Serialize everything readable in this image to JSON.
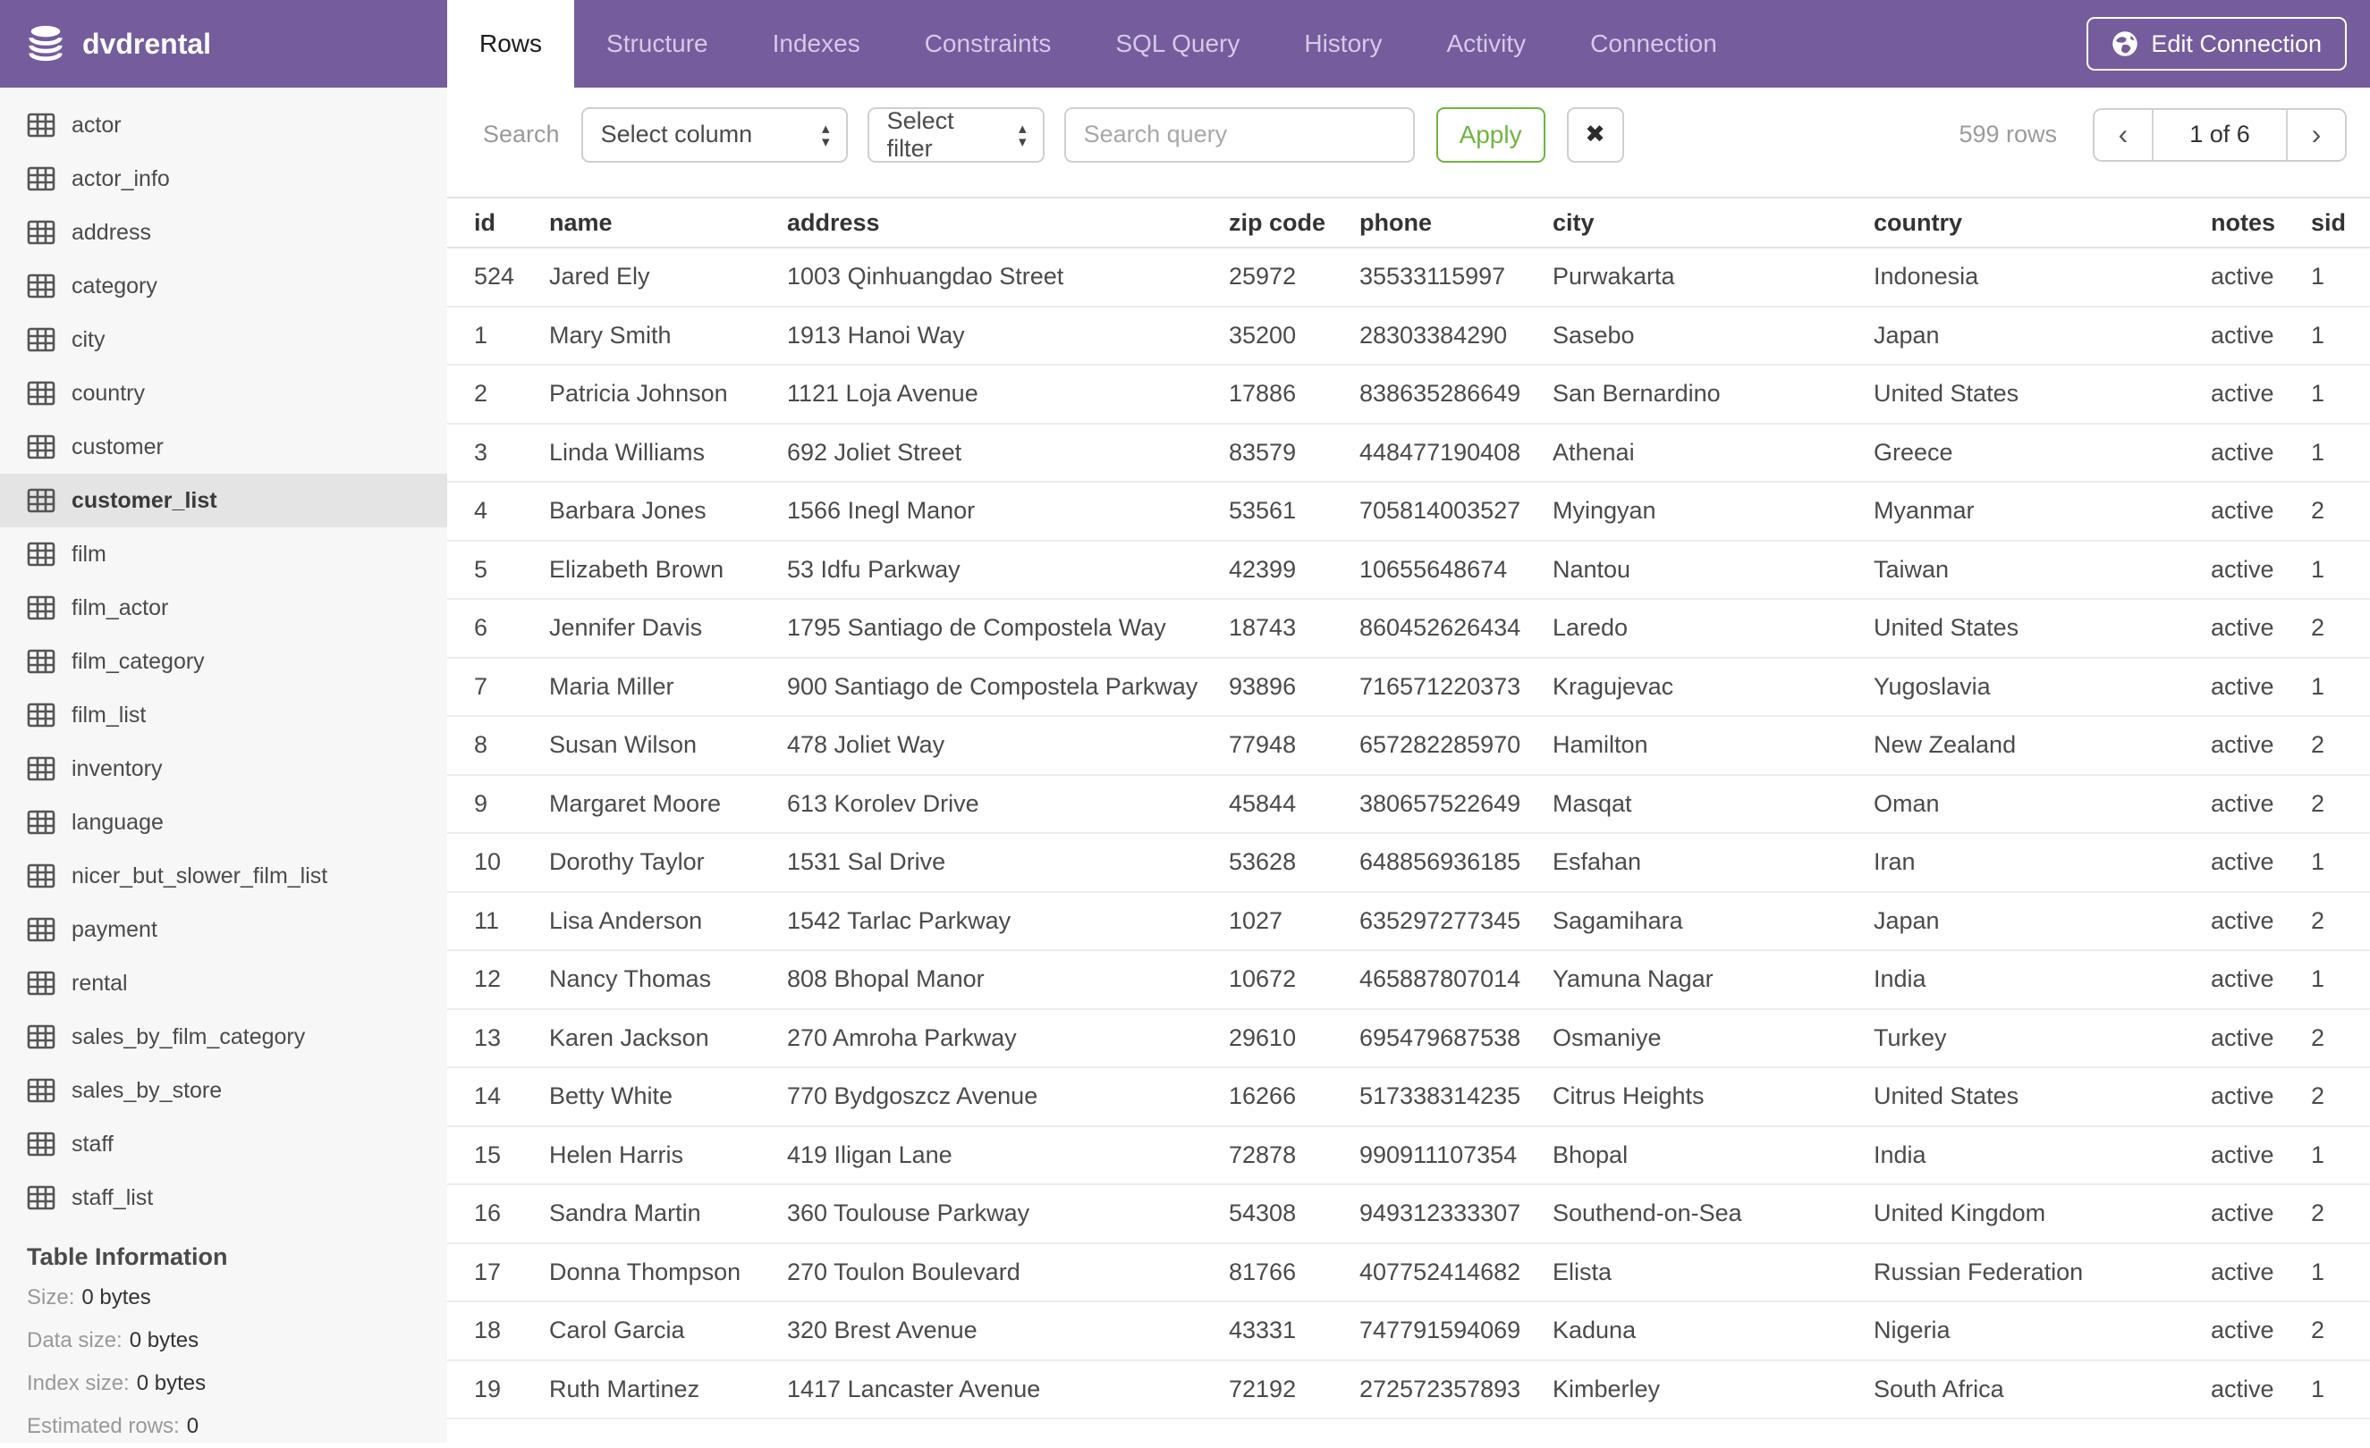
{
  "header": {
    "database_name": "dvdrental",
    "tabs": [
      {
        "label": "Rows",
        "active": true
      },
      {
        "label": "Structure",
        "active": false
      },
      {
        "label": "Indexes",
        "active": false
      },
      {
        "label": "Constraints",
        "active": false
      },
      {
        "label": "SQL Query",
        "active": false
      },
      {
        "label": "History",
        "active": false
      },
      {
        "label": "Activity",
        "active": false
      },
      {
        "label": "Connection",
        "active": false
      }
    ],
    "edit_connection_label": "Edit Connection",
    "colors": {
      "header_bg": "#745c9d",
      "active_tab_bg": "#ffffff",
      "tab_text": "#d6c9e6"
    }
  },
  "sidebar": {
    "selected_table": "customer_list",
    "tables": [
      "actor",
      "actor_info",
      "address",
      "category",
      "city",
      "country",
      "customer",
      "customer_list",
      "film",
      "film_actor",
      "film_category",
      "film_list",
      "inventory",
      "language",
      "nicer_but_slower_film_list",
      "payment",
      "rental",
      "sales_by_film_category",
      "sales_by_store",
      "staff",
      "staff_list"
    ],
    "table_information": {
      "heading": "Table Information",
      "items": [
        {
          "label": "Size:",
          "value": "0 bytes"
        },
        {
          "label": "Data size:",
          "value": "0 bytes"
        },
        {
          "label": "Index size:",
          "value": "0 bytes"
        },
        {
          "label": "Estimated rows:",
          "value": "0"
        }
      ]
    }
  },
  "toolbar": {
    "search_label": "Search",
    "column_select_value": "Select column",
    "filter_select_value": "Select filter",
    "query_placeholder": "Search query",
    "query_value": "",
    "apply_label": "Apply",
    "clear_glyph": "✖",
    "row_count": "599 rows",
    "pagination": {
      "prev_glyph": "‹",
      "current": "1 of 6",
      "next_glyph": "›"
    },
    "select_arrow_up": "▴",
    "select_arrow_down": "▾",
    "accent_green": "#6fb53f"
  },
  "table": {
    "columns": [
      {
        "key": "id",
        "label": "id"
      },
      {
        "key": "name",
        "label": "name"
      },
      {
        "key": "address",
        "label": "address"
      },
      {
        "key": "zip_code",
        "label": "zip code"
      },
      {
        "key": "phone",
        "label": "phone"
      },
      {
        "key": "city",
        "label": "city"
      },
      {
        "key": "country",
        "label": "country"
      },
      {
        "key": "notes",
        "label": "notes"
      },
      {
        "key": "sid",
        "label": "sid"
      }
    ],
    "rows": [
      [
        "524",
        "Jared Ely",
        "1003 Qinhuangdao Street",
        "25972",
        "35533115997",
        "Purwakarta",
        "Indonesia",
        "active",
        "1"
      ],
      [
        "1",
        "Mary Smith",
        "1913 Hanoi Way",
        "35200",
        "28303384290",
        "Sasebo",
        "Japan",
        "active",
        "1"
      ],
      [
        "2",
        "Patricia Johnson",
        "1121 Loja Avenue",
        "17886",
        "838635286649",
        "San Bernardino",
        "United States",
        "active",
        "1"
      ],
      [
        "3",
        "Linda Williams",
        "692 Joliet Street",
        "83579",
        "448477190408",
        "Athenai",
        "Greece",
        "active",
        "1"
      ],
      [
        "4",
        "Barbara Jones",
        "1566 Inegl Manor",
        "53561",
        "705814003527",
        "Myingyan",
        "Myanmar",
        "active",
        "2"
      ],
      [
        "5",
        "Elizabeth Brown",
        "53 Idfu Parkway",
        "42399",
        "10655648674",
        "Nantou",
        "Taiwan",
        "active",
        "1"
      ],
      [
        "6",
        "Jennifer Davis",
        "1795 Santiago de Compostela Way",
        "18743",
        "860452626434",
        "Laredo",
        "United States",
        "active",
        "2"
      ],
      [
        "7",
        "Maria Miller",
        "900 Santiago de Compostela Parkway",
        "93896",
        "716571220373",
        "Kragujevac",
        "Yugoslavia",
        "active",
        "1"
      ],
      [
        "8",
        "Susan Wilson",
        "478 Joliet Way",
        "77948",
        "657282285970",
        "Hamilton",
        "New Zealand",
        "active",
        "2"
      ],
      [
        "9",
        "Margaret Moore",
        "613 Korolev Drive",
        "45844",
        "380657522649",
        "Masqat",
        "Oman",
        "active",
        "2"
      ],
      [
        "10",
        "Dorothy Taylor",
        "1531 Sal Drive",
        "53628",
        "648856936185",
        "Esfahan",
        "Iran",
        "active",
        "1"
      ],
      [
        "11",
        "Lisa Anderson",
        "1542 Tarlac Parkway",
        "1027",
        "635297277345",
        "Sagamihara",
        "Japan",
        "active",
        "2"
      ],
      [
        "12",
        "Nancy Thomas",
        "808 Bhopal Manor",
        "10672",
        "465887807014",
        "Yamuna Nagar",
        "India",
        "active",
        "1"
      ],
      [
        "13",
        "Karen Jackson",
        "270 Amroha Parkway",
        "29610",
        "695479687538",
        "Osmaniye",
        "Turkey",
        "active",
        "2"
      ],
      [
        "14",
        "Betty White",
        "770 Bydgoszcz Avenue",
        "16266",
        "517338314235",
        "Citrus Heights",
        "United States",
        "active",
        "2"
      ],
      [
        "15",
        "Helen Harris",
        "419 Iligan Lane",
        "72878",
        "990911107354",
        "Bhopal",
        "India",
        "active",
        "1"
      ],
      [
        "16",
        "Sandra Martin",
        "360 Toulouse Parkway",
        "54308",
        "949312333307",
        "Southend-on-Sea",
        "United Kingdom",
        "active",
        "2"
      ],
      [
        "17",
        "Donna Thompson",
        "270 Toulon Boulevard",
        "81766",
        "407752414682",
        "Elista",
        "Russian Federation",
        "active",
        "1"
      ],
      [
        "18",
        "Carol Garcia",
        "320 Brest Avenue",
        "43331",
        "747791594069",
        "Kaduna",
        "Nigeria",
        "active",
        "2"
      ],
      [
        "19",
        "Ruth Martinez",
        "1417 Lancaster Avenue",
        "72192",
        "272572357893",
        "Kimberley",
        "South Africa",
        "active",
        "1"
      ]
    ]
  }
}
